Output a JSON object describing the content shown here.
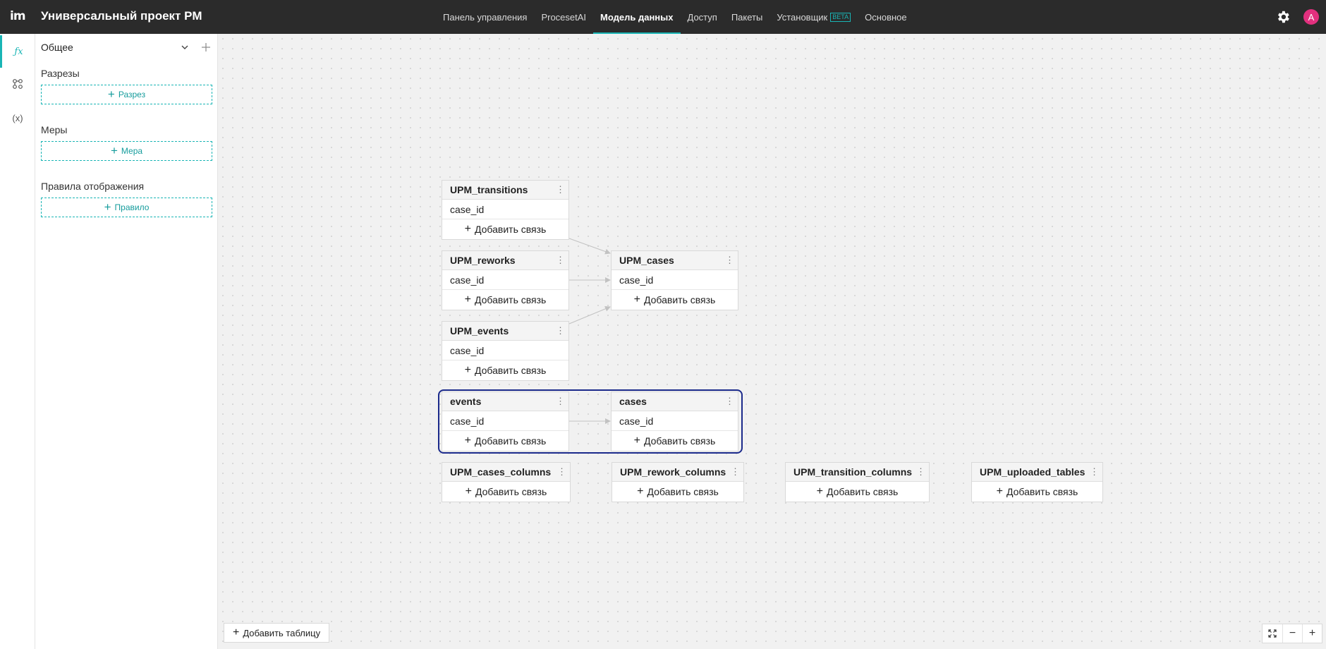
{
  "app": {
    "logo": "im",
    "project_title": "Универсальный проект PM",
    "avatar_initial": "A",
    "beta_badge": "BETA"
  },
  "nav": [
    {
      "label": "Панель управления",
      "active": false
    },
    {
      "label": "ProcesetAI",
      "active": false
    },
    {
      "label": "Модель данных",
      "active": true
    },
    {
      "label": "Доступ",
      "active": false
    },
    {
      "label": "Пакеты",
      "active": false
    },
    {
      "label": "Установщик",
      "active": false
    },
    {
      "label": "Основное",
      "active": false
    }
  ],
  "rail": [
    {
      "icon": "fx-icon",
      "active": true
    },
    {
      "icon": "model-graph-icon",
      "active": false
    },
    {
      "icon": "variable-icon",
      "glyph": "(x)",
      "active": false
    }
  ],
  "panel": {
    "header": "Общее",
    "sections": [
      {
        "label": "Разрезы",
        "button": "Разрез"
      },
      {
        "label": "Меры",
        "button": "Мера"
      },
      {
        "label": "Правила отображения",
        "button": "Правило"
      }
    ]
  },
  "canvas": {
    "add_link_label": "Добавить связь",
    "field_label": "case_id",
    "tables": [
      {
        "name": "UPM_transitions",
        "fields": [
          "case_id"
        ]
      },
      {
        "name": "UPM_reworks",
        "fields": [
          "case_id"
        ]
      },
      {
        "name": "UPM_events",
        "fields": [
          "case_id"
        ]
      },
      {
        "name": "UPM_cases",
        "fields": [
          "case_id"
        ]
      },
      {
        "name": "events",
        "fields": [
          "case_id"
        ]
      },
      {
        "name": "cases",
        "fields": [
          "case_id"
        ]
      },
      {
        "name": "UPM_cases_columns",
        "fields": []
      },
      {
        "name": "UPM_rework_columns",
        "fields": []
      },
      {
        "name": "UPM_transition_columns",
        "fields": []
      },
      {
        "name": "UPM_uploaded_tables",
        "fields": []
      }
    ],
    "add_table_label": "Добавить таблицу"
  },
  "colors": {
    "accent": "#19b5b5",
    "topbar": "#2b2b2b",
    "selection": "#1b2a8b",
    "avatar": "#e2307e"
  }
}
